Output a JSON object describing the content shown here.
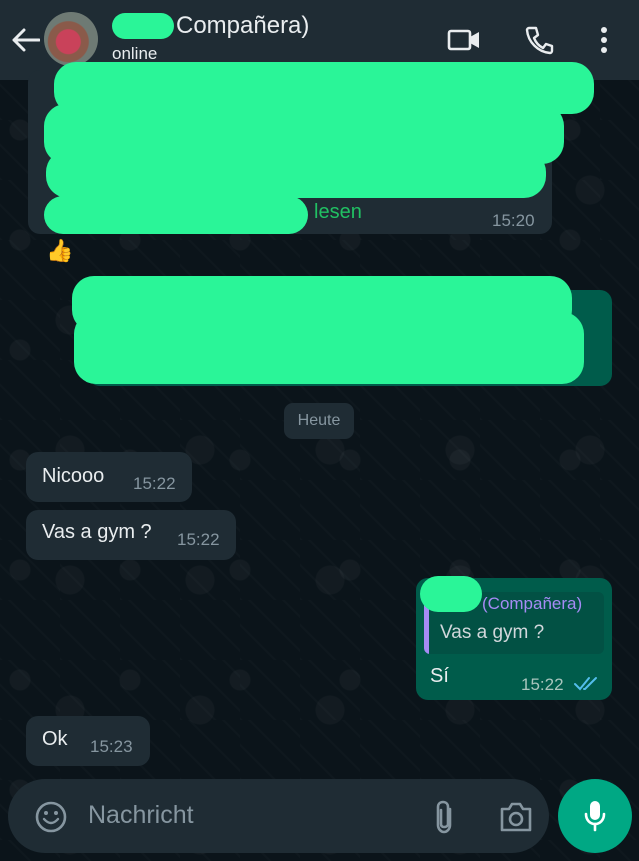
{
  "header": {
    "contact_name": "Compañera)",
    "status": "online"
  },
  "messages": {
    "top_incoming": {
      "visible_text": "lesen",
      "time": "15:20",
      "reaction": "👍"
    },
    "date_chip": "Heute",
    "m1": {
      "text": "Nicooo",
      "time": "15:22"
    },
    "m2": {
      "text": "Vas a gym ?",
      "time": "15:22"
    },
    "reply": {
      "quoted_author": "(Compañera)",
      "quoted_text": "Vas a gym ?",
      "text": "Sí",
      "time": "15:22"
    },
    "m3": {
      "text": "Ok",
      "time": "15:23"
    }
  },
  "composer": {
    "placeholder": "Nachricht"
  },
  "colors": {
    "background": "#0b141a",
    "header": "#1f2c34",
    "incoming_bubble": "#1f2c34",
    "outgoing_bubble": "#005c4b",
    "accent": "#00a884",
    "redaction": "#2af598",
    "read_ticks": "#53bdeb"
  }
}
